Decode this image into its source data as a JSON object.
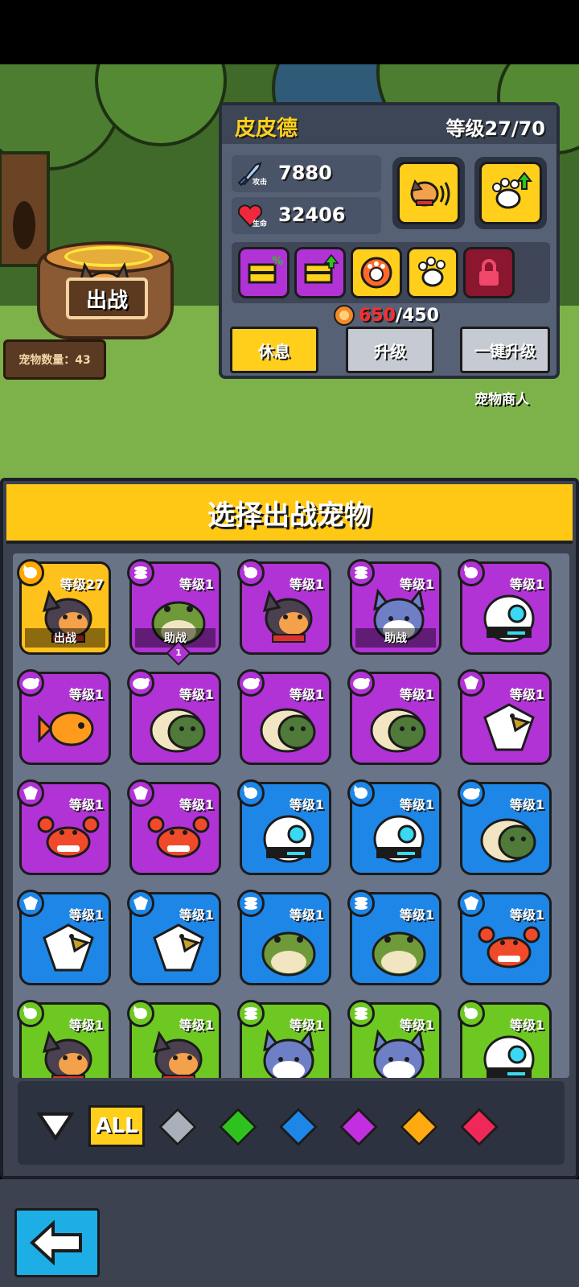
{
  "scene": {
    "sortie_label": "出战",
    "pet_count_label": "宠物数量：43",
    "merchant_label": "宠物商人"
  },
  "info": {
    "name": "皮皮德",
    "level": "等级27/70",
    "attack_label": "攻击",
    "attack_value": "7880",
    "hp_label": "生命",
    "hp_value": "32406",
    "cost_current": "650",
    "cost_total": "/450",
    "btn_rest": "休息",
    "btn_upgrade": "升级",
    "btn_auto_upgrade": "一键升级",
    "colors": {
      "accent": "#ffcf1c",
      "cost_red": "#ff2d2d"
    }
  },
  "panel": {
    "title": "选择出战宠物",
    "cards": [
      {
        "level": "等级27",
        "tag": "出战",
        "color": "gold",
        "pet": "dog-icon",
        "type": "dog-badge-icon"
      },
      {
        "level": "等级1",
        "tag": "助战",
        "color": "purple",
        "pet": "frog-icon",
        "type": "coin-badge-icon",
        "pin": "1"
      },
      {
        "level": "等级1",
        "tag": "",
        "color": "purple",
        "pet": "dog-icon",
        "type": "dog-badge-icon"
      },
      {
        "level": "等级1",
        "tag": "助战",
        "color": "purple",
        "pet": "cat-icon",
        "type": "coin-badge-icon"
      },
      {
        "level": "等级1",
        "tag": "",
        "color": "purple",
        "pet": "robot-icon",
        "type": "dog-badge-icon"
      },
      {
        "level": "等级1",
        "tag": "",
        "color": "purple",
        "pet": "fish-icon",
        "type": "turtle-badge-icon"
      },
      {
        "level": "等级1",
        "tag": "",
        "color": "purple",
        "pet": "turtle-icon",
        "type": "turtle-badge-icon"
      },
      {
        "level": "等级1",
        "tag": "",
        "color": "purple",
        "pet": "turtle-icon",
        "type": "turtle-badge-icon"
      },
      {
        "level": "等级1",
        "tag": "",
        "color": "purple",
        "pet": "turtle-icon",
        "type": "turtle-badge-icon"
      },
      {
        "level": "等级1",
        "tag": "",
        "color": "purple",
        "pet": "eagle-icon",
        "type": "eagle-badge-icon"
      },
      {
        "level": "等级1",
        "tag": "",
        "color": "purple",
        "pet": "crab-icon",
        "type": "eagle-badge-icon"
      },
      {
        "level": "等级1",
        "tag": "",
        "color": "purple",
        "pet": "crab-icon",
        "type": "eagle-badge-icon"
      },
      {
        "level": "等级1",
        "tag": "",
        "color": "blue",
        "pet": "robot-icon",
        "type": "dog-badge-icon"
      },
      {
        "level": "等级1",
        "tag": "",
        "color": "blue",
        "pet": "robot-icon",
        "type": "dog-badge-icon"
      },
      {
        "level": "等级1",
        "tag": "",
        "color": "blue",
        "pet": "turtle-icon",
        "type": "turtle-badge-icon"
      },
      {
        "level": "等级1",
        "tag": "",
        "color": "blue",
        "pet": "eagle-icon",
        "type": "eagle-badge-icon"
      },
      {
        "level": "等级1",
        "tag": "",
        "color": "blue",
        "pet": "eagle-icon",
        "type": "eagle-badge-icon"
      },
      {
        "level": "等级1",
        "tag": "",
        "color": "blue",
        "pet": "frog-icon",
        "type": "coin-badge-icon"
      },
      {
        "level": "等级1",
        "tag": "",
        "color": "blue",
        "pet": "frog-icon",
        "type": "coin-badge-icon"
      },
      {
        "level": "等级1",
        "tag": "",
        "color": "blue",
        "pet": "crab-icon",
        "type": "eagle-badge-icon"
      },
      {
        "level": "等级1",
        "tag": "",
        "color": "green",
        "pet": "dog-icon",
        "type": "dog-badge-icon"
      },
      {
        "level": "等级1",
        "tag": "",
        "color": "green",
        "pet": "dog-icon",
        "type": "dog-badge-icon"
      },
      {
        "level": "等级1",
        "tag": "",
        "color": "green",
        "pet": "cat-icon",
        "type": "coin-badge-icon"
      },
      {
        "level": "等级1",
        "tag": "",
        "color": "green",
        "pet": "cat-icon",
        "type": "coin-badge-icon"
      },
      {
        "level": "等级1",
        "tag": "",
        "color": "green",
        "pet": "robot-icon",
        "type": "dog-badge-icon"
      }
    ]
  },
  "filter": {
    "all_label": "ALL",
    "gems": [
      {
        "name": "gray-gem-icon",
        "color": "#a9b0bc"
      },
      {
        "name": "green-gem-icon",
        "color": "#2fc21f"
      },
      {
        "name": "blue-gem-icon",
        "color": "#1e86e6"
      },
      {
        "name": "purple-gem-icon",
        "color": "#c22fe0"
      },
      {
        "name": "orange-gem-icon",
        "color": "#ffaa10"
      },
      {
        "name": "red-gem-icon",
        "color": "#f0285a"
      }
    ]
  }
}
